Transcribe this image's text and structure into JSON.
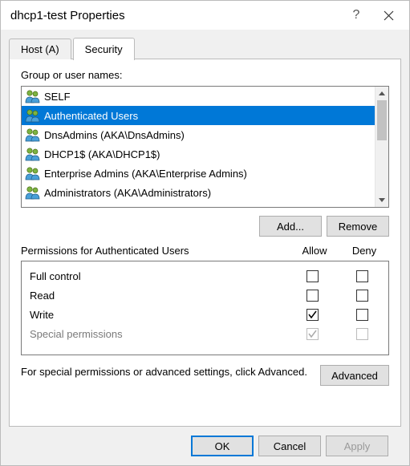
{
  "title": "dhcp1-test Properties",
  "tabs": {
    "host": "Host (A)",
    "security": "Security"
  },
  "group_label": "Group or user names:",
  "groups": [
    {
      "name": "SELF"
    },
    {
      "name": "Authenticated Users"
    },
    {
      "name": "DnsAdmins (AKA\\DnsAdmins)"
    },
    {
      "name": "DHCP1$ (AKA\\DHCP1$)"
    },
    {
      "name": "Enterprise Admins (AKA\\Enterprise Admins)"
    },
    {
      "name": "Administrators (AKA\\Administrators)"
    }
  ],
  "buttons": {
    "add": "Add...",
    "remove": "Remove",
    "advanced": "Advanced",
    "ok": "OK",
    "cancel": "Cancel",
    "apply": "Apply"
  },
  "perm_label": "Permissions for Authenticated Users",
  "perm_cols": {
    "allow": "Allow",
    "deny": "Deny"
  },
  "perms": [
    {
      "name": "Full control",
      "allow": false,
      "deny": false,
      "disabled": false
    },
    {
      "name": "Read",
      "allow": false,
      "deny": false,
      "disabled": false
    },
    {
      "name": "Write",
      "allow": true,
      "deny": false,
      "disabled": false
    },
    {
      "name": "Special permissions",
      "allow": true,
      "deny": false,
      "disabled": true
    }
  ],
  "adv_text": "For special permissions or advanced settings, click Advanced."
}
